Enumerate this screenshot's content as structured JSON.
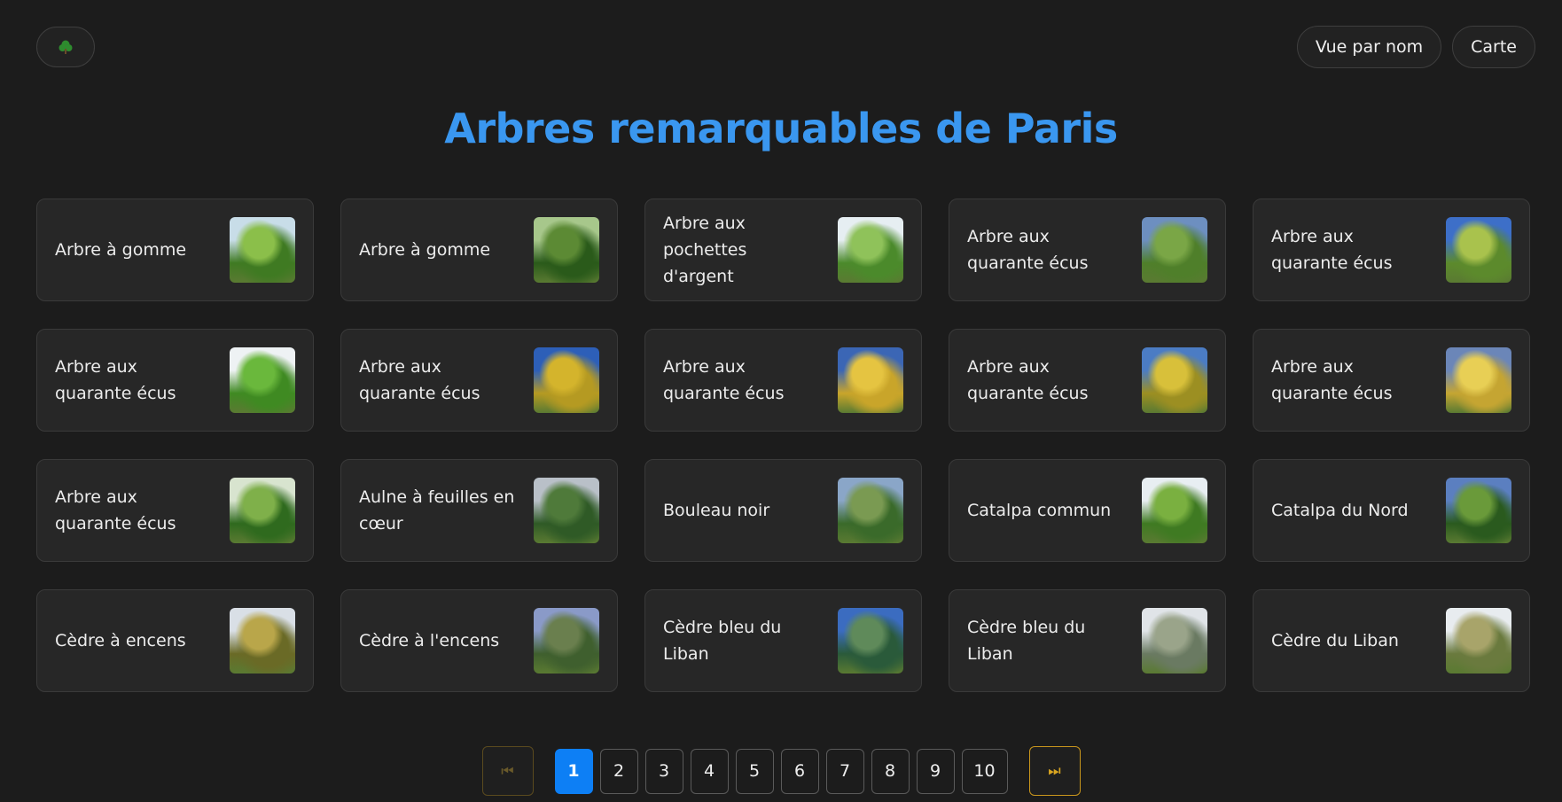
{
  "header": {
    "home_icon": "tree-icon",
    "nav": {
      "by_name_label": "Vue par nom",
      "map_label": "Carte"
    }
  },
  "title": "Arbres remarquables de Paris",
  "cards": [
    {
      "name": "Arbre à gomme",
      "colors": [
        "#3f7a22",
        "#8bbf4a",
        "#c8dde8"
      ]
    },
    {
      "name": "Arbre à gomme",
      "colors": [
        "#2a5a1a",
        "#5c8a34",
        "#a7c78b"
      ]
    },
    {
      "name": "Arbre aux pochettes d'argent",
      "colors": [
        "#4b8a2b",
        "#8fc25a",
        "#e6eef2"
      ]
    },
    {
      "name": "Arbre aux quarante écus",
      "colors": [
        "#4f7f2a",
        "#7aa646",
        "#6d8fc0"
      ]
    },
    {
      "name": "Arbre aux quarante écus",
      "colors": [
        "#5c8a2c",
        "#a9c24d",
        "#3d6fc8"
      ]
    },
    {
      "name": "Arbre aux quarante écus",
      "colors": [
        "#3f8a22",
        "#6ab83c",
        "#eef2f4"
      ]
    },
    {
      "name": "Arbre aux quarante écus",
      "colors": [
        "#b59a22",
        "#d4b42c",
        "#2d5fb8"
      ]
    },
    {
      "name": "Arbre aux quarante écus",
      "colors": [
        "#c9a52a",
        "#e5c441",
        "#3b66b5"
      ]
    },
    {
      "name": "Arbre aux quarante écus",
      "colors": [
        "#9c8f22",
        "#d8c03a",
        "#4b7cc4"
      ]
    },
    {
      "name": "Arbre aux quarante écus",
      "colors": [
        "#c5a532",
        "#e8cf55",
        "#6b86b8"
      ]
    },
    {
      "name": "Arbre aux quarante écus",
      "colors": [
        "#2f6a1e",
        "#7fb04a",
        "#d8e4cf"
      ]
    },
    {
      "name": "Aulne à feuilles en cœur",
      "colors": [
        "#2f5a26",
        "#4f7a3a",
        "#b9c0c8"
      ]
    },
    {
      "name": "Bouleau noir",
      "colors": [
        "#3a6a2a",
        "#7a9a52",
        "#8aa6c8"
      ]
    },
    {
      "name": "Catalpa commun",
      "colors": [
        "#3f7a22",
        "#7ab040",
        "#e8eef2"
      ]
    },
    {
      "name": "Catalpa du Nord",
      "colors": [
        "#2a5a1e",
        "#6a9a3a",
        "#5b7fc0"
      ]
    },
    {
      "name": "Cèdre à encens",
      "colors": [
        "#6a6a26",
        "#b9a64a",
        "#d9dfe6"
      ]
    },
    {
      "name": "Cèdre à l'encens",
      "colors": [
        "#3f5f2e",
        "#6a7f4e",
        "#8a9ac8"
      ]
    },
    {
      "name": "Cèdre bleu du Liban",
      "colors": [
        "#2a5a3a",
        "#5f8a5a",
        "#3b6cc0"
      ]
    },
    {
      "name": "Cèdre bleu du Liban",
      "colors": [
        "#6a7a62",
        "#9aa48a",
        "#e0e4e8"
      ]
    },
    {
      "name": "Cèdre du Liban",
      "colors": [
        "#6a7a3e",
        "#a8a46a",
        "#e8ecef"
      ]
    }
  ],
  "pagination": {
    "first_icon": "skip-first-icon",
    "last_icon": "skip-last-icon",
    "pages": [
      "1",
      "2",
      "3",
      "4",
      "5",
      "6",
      "7",
      "8",
      "9",
      "10"
    ],
    "current": "1"
  }
}
